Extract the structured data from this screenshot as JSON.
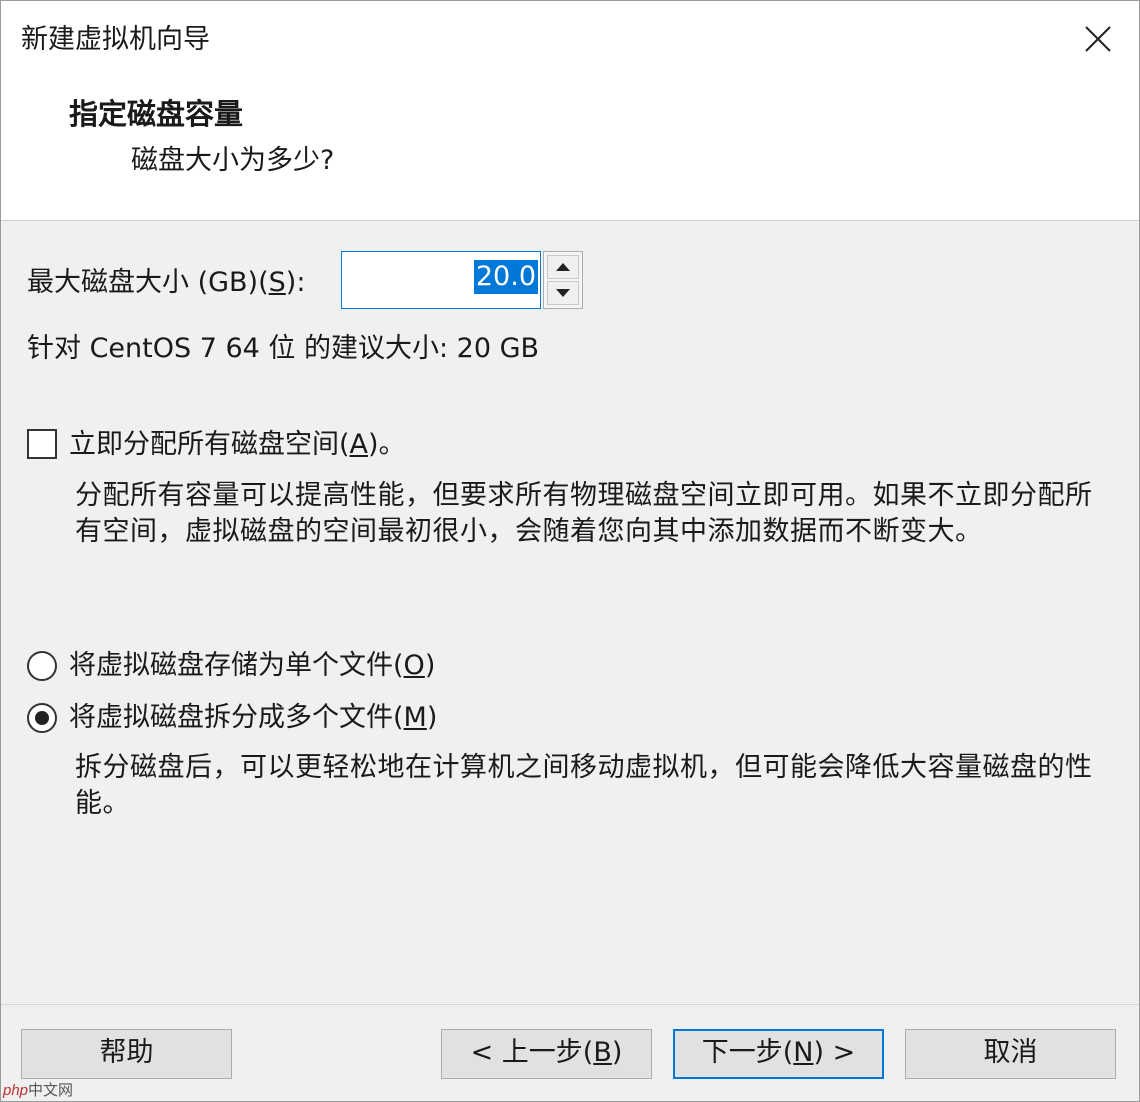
{
  "window": {
    "title": "新建虚拟机向导"
  },
  "header": {
    "heading": "指定磁盘容量",
    "subheading": "磁盘大小为多少?"
  },
  "disk_size": {
    "label_prefix": "最大磁盘大小 (GB)(",
    "label_key": "S",
    "label_suffix": "):",
    "value": "20.0"
  },
  "recommendation": "针对 CentOS 7 64 位 的建议大小: 20 GB",
  "allocate_all": {
    "label_prefix": "立即分配所有磁盘空间(",
    "label_key": "A",
    "label_suffix": ")。",
    "checked": false,
    "description": "分配所有容量可以提高性能，但要求所有物理磁盘空间立即可用。如果不立即分配所有空间，虚拟磁盘的空间最初很小，会随着您向其中添加数据而不断变大。"
  },
  "storage_options": {
    "single_file": {
      "label_prefix": "将虚拟磁盘存储为单个文件(",
      "label_key": "O",
      "label_suffix": ")",
      "selected": false
    },
    "multiple_files": {
      "label_prefix": "将虚拟磁盘拆分成多个文件(",
      "label_key": "M",
      "label_suffix": ")",
      "selected": true
    },
    "split_description": "拆分磁盘后，可以更轻松地在计算机之间移动虚拟机，但可能会降低大容量磁盘的性能。"
  },
  "buttons": {
    "help": "帮助",
    "back_prefix": "< 上一步(",
    "back_key": "B",
    "back_suffix": ")",
    "next_prefix": "下一步(",
    "next_key": "N",
    "next_suffix": ") >",
    "cancel": "取消"
  },
  "watermark": {
    "brand": "php",
    "site": "中文网"
  },
  "colors": {
    "accent": "#0078d7",
    "background": "#f0f0f0"
  }
}
